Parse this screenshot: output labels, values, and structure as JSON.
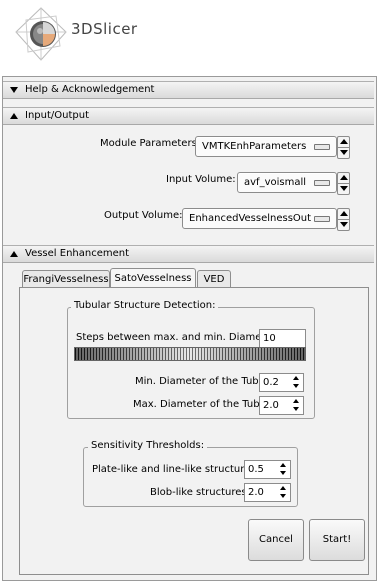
{
  "app": {
    "title": "3DSlicer"
  },
  "sections": {
    "help": {
      "label": "Help & Acknowledgement"
    },
    "io": {
      "label": "Input/Output",
      "module_parameters": {
        "label": "Module Parameters:",
        "value": "VMTKEnhParameters"
      },
      "input_volume": {
        "label": "Input Volume:",
        "value": "avf_voismall"
      },
      "output_volume": {
        "label": "Output Volume:",
        "value": "EnhancedVesselnessOut"
      }
    },
    "vessel": {
      "label": "Vessel Enhancement",
      "tabs": [
        {
          "label": "FrangiVesselness"
        },
        {
          "label": "SatoVesselness"
        },
        {
          "label": "VED"
        }
      ],
      "tubular": {
        "title": "Tubular Structure Detection:",
        "steps_label": "Steps between max. and min. Diameter",
        "steps_value": "10",
        "min_label": "Min. Diameter of the Tube:",
        "min_value": "0.2",
        "max_label": "Max. Diameter of the Tube:",
        "max_value": "2.0"
      },
      "sensitivity": {
        "title": "Sensitivity Thresholds:",
        "plate_label": "Plate-like and line-like structures:",
        "plate_value": "0.5",
        "blob_label": "Blob-like structures:",
        "blob_value": "2.0"
      },
      "buttons": {
        "cancel": "Cancel",
        "start": "Start!"
      }
    }
  }
}
